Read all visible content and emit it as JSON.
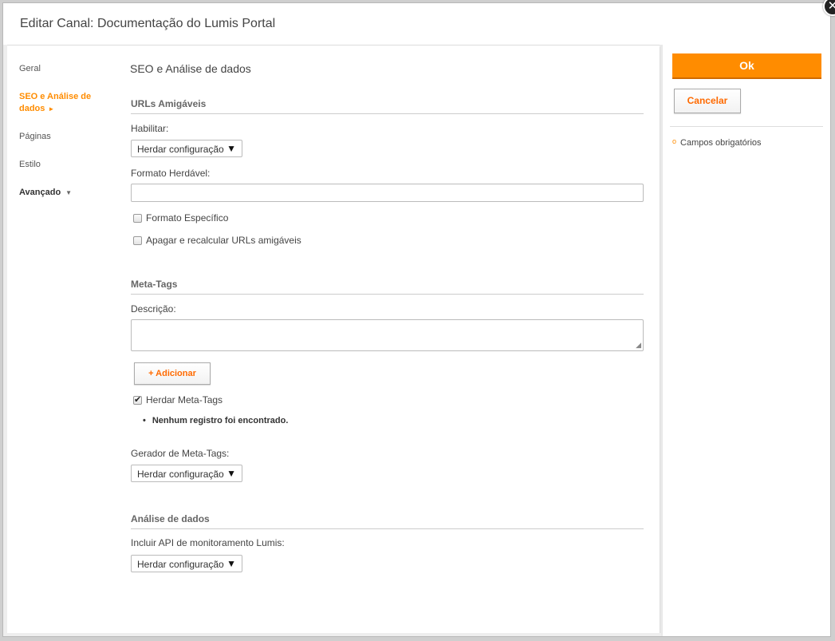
{
  "dialog": {
    "title": "Editar Canal: Documentação do Lumis Portal",
    "close_symbol": "✕"
  },
  "nav": {
    "items": [
      {
        "label": "Geral"
      },
      {
        "label": "SEO e Análise de dados",
        "active": true
      },
      {
        "label": "Páginas"
      },
      {
        "label": "Estilo"
      },
      {
        "label": "Avançado",
        "has_submenu": true
      }
    ]
  },
  "main": {
    "page_title": "SEO e Análise de dados",
    "urls": {
      "section_title": "URLs Amigáveis",
      "enable_label": "Habilitar:",
      "enable_value": "Herdar configuração",
      "format_label": "Formato Herdável:",
      "format_value": "",
      "specific_format_label": "Formato Específico",
      "specific_format_checked": false,
      "recalc_label": "Apagar e recalcular URLs amigáveis",
      "recalc_checked": false
    },
    "meta": {
      "section_title": "Meta-Tags",
      "description_label": "Descrição:",
      "description_value": "",
      "add_button": "+ Adicionar",
      "inherit_label": "Herdar Meta-Tags",
      "inherit_checked": true,
      "empty_message": "Nenhum registro foi encontrado.",
      "generator_label": "Gerador de Meta-Tags:",
      "generator_value": "Herdar configuração"
    },
    "analytics": {
      "section_title": "Análise de dados",
      "api_label": "Incluir API de monitoramento Lumis:",
      "api_value": "Herdar configuração"
    }
  },
  "side": {
    "ok_label": "Ok",
    "cancel_label": "Cancelar",
    "required_note": "Campos obrigatórios"
  },
  "colors": {
    "accent": "#ff8c00",
    "accent_text": "#ff6a00"
  }
}
